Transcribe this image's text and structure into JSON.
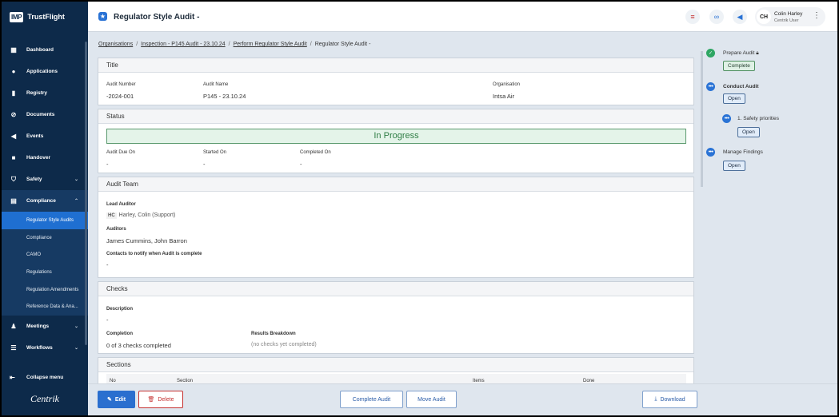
{
  "app": {
    "logo": "IMP",
    "name": "TrustFlight",
    "page_title": "Regulator Style Audit -"
  },
  "sidebar": {
    "items": [
      {
        "label": "Dashboard",
        "icon": "dashboard-icon"
      },
      {
        "label": "Applications",
        "icon": "person-icon"
      },
      {
        "label": "Registry",
        "icon": "book-icon"
      },
      {
        "label": "Documents",
        "icon": "paperclip-icon"
      },
      {
        "label": "Events",
        "icon": "megaphone-icon"
      },
      {
        "label": "Handover",
        "icon": "truck-icon"
      },
      {
        "label": "Safety",
        "icon": "shield-icon"
      },
      {
        "label": "Compliance",
        "icon": "clipboard-icon"
      }
    ],
    "compliance_sub": [
      "Regulator Style Audits",
      "Compliance",
      "CAMO",
      "Regulations",
      "Regulation Amendments",
      "Reference Data & Ana..."
    ],
    "items_after": [
      {
        "label": "Meetings",
        "icon": "meeting-icon"
      },
      {
        "label": "Workflows",
        "icon": "workflow-icon"
      }
    ],
    "collapse_label": "Collapse menu",
    "footer_brand": "Centrik"
  },
  "user": {
    "initials": "CH",
    "name": "Colin Harley",
    "role": "Centrik User"
  },
  "breadcrumb": {
    "items": [
      "Organisations",
      "Inspection - P145 Audit - 23.10.24",
      "Perform Regulator Style Audit"
    ],
    "current": "Regulator Style Audit -"
  },
  "title_card": {
    "heading": "Title",
    "audit_number_label": "Audit Number",
    "audit_number": "-2024-001",
    "audit_name_label": "Audit Name",
    "audit_name": "P145 - 23.10.24",
    "organisation_label": "Organisation",
    "organisation": "Intsa Air"
  },
  "status_card": {
    "heading": "Status",
    "status": "In Progress",
    "due_label": "Audit Due On",
    "due": "-",
    "started_label": "Started On",
    "started": "-",
    "completed_label": "Completed On",
    "completed": "-"
  },
  "team_card": {
    "heading": "Audit Team",
    "lead_label": "Lead Auditor",
    "lead_initials": "HC",
    "lead": "Harley, Colin (Support)",
    "auditors_label": "Auditors",
    "auditors": "James Cummins, John Barron",
    "contacts_label": "Contacts to notify when Audit is complete",
    "contacts": "-"
  },
  "checks_card": {
    "heading": "Checks",
    "description_label": "Description",
    "description": "-",
    "completion_label": "Completion",
    "completion": "0 of 3 checks completed",
    "breakdown_label": "Results Breakdown",
    "breakdown": "(no checks yet completed)"
  },
  "sections_card": {
    "heading": "Sections",
    "columns": [
      "No",
      "Section",
      "Items",
      "Done"
    ]
  },
  "steps": [
    {
      "label": "Prepare Audit",
      "button": "Complete",
      "state": "done"
    },
    {
      "label": "Conduct Audit",
      "button": "Open",
      "state": "current"
    },
    {
      "label": "1. Safety priorities",
      "button": "Open",
      "state": "current"
    },
    {
      "label": "Manage Findings",
      "button": "Open",
      "state": "current"
    }
  ],
  "footer": {
    "edit": "Edit",
    "delete": "Delete",
    "complete": "Complete Audit",
    "move": "Move Audit",
    "download": "Download"
  }
}
